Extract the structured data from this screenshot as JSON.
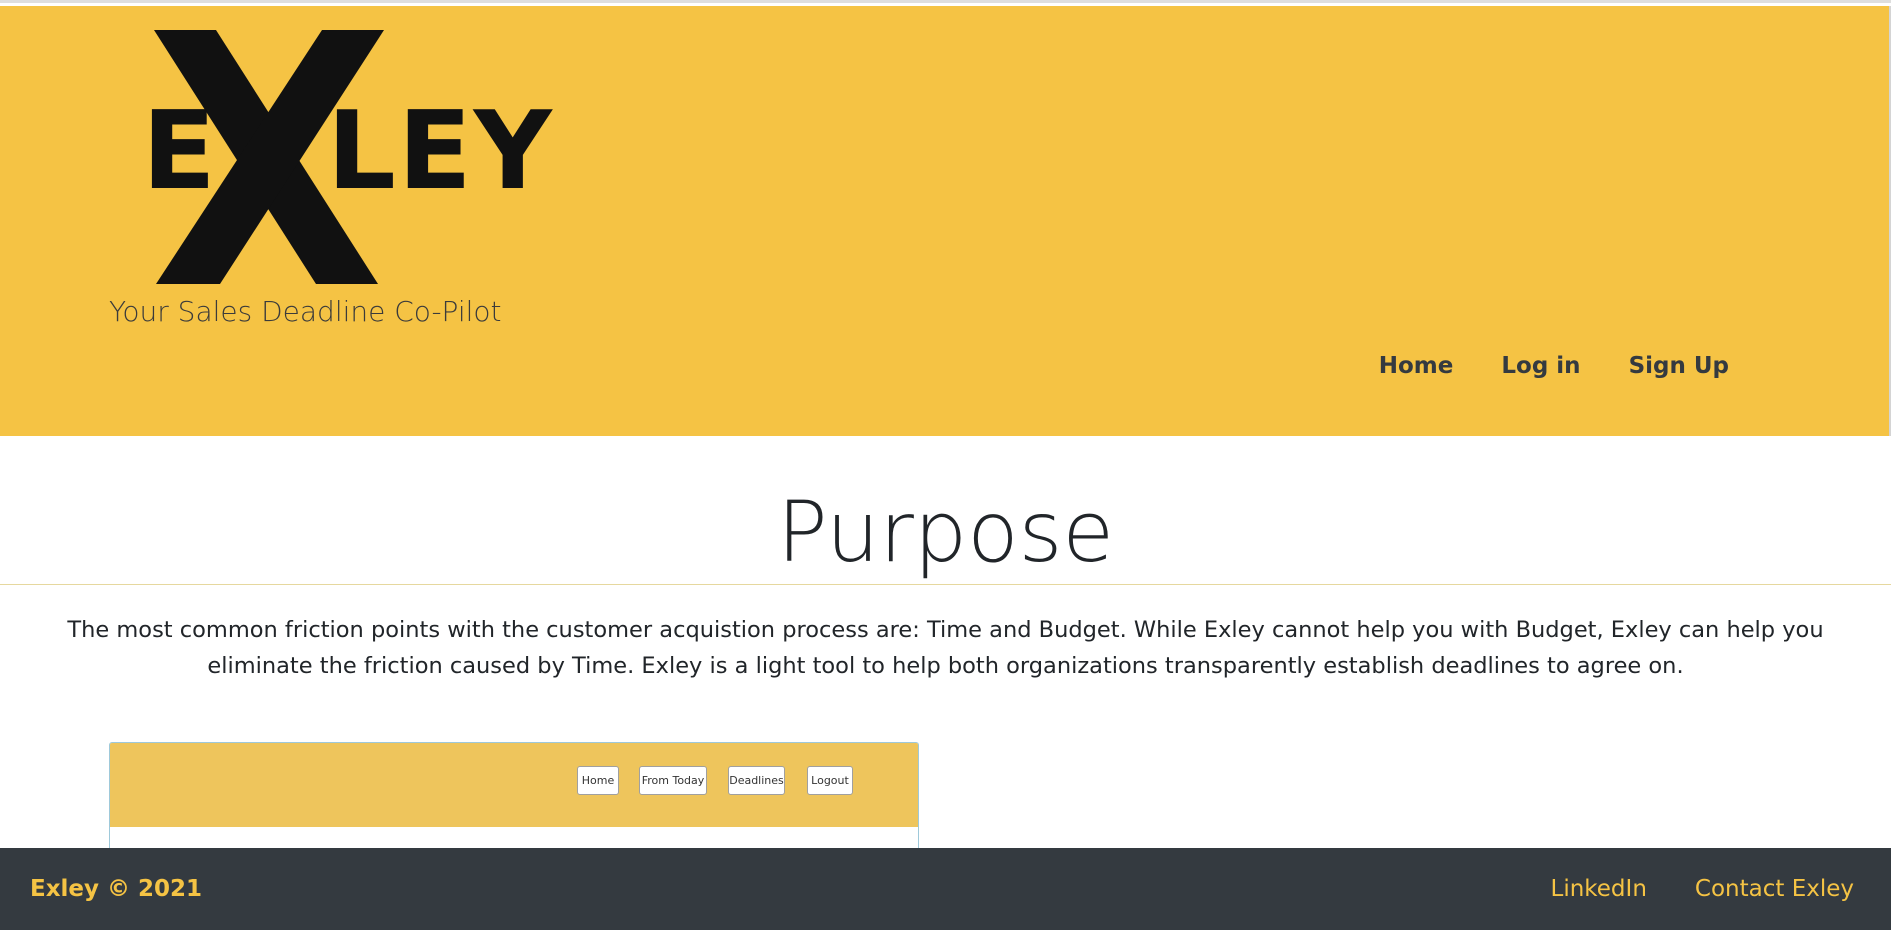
{
  "brand": {
    "logo_text": "EXLEY",
    "logo_left": "E",
    "logo_right": "LEY",
    "tagline": "Your Sales Deadline Co-Pilot"
  },
  "nav": {
    "items": [
      {
        "label": "Home"
      },
      {
        "label": "Log in"
      },
      {
        "label": "Sign Up"
      }
    ]
  },
  "main": {
    "title": "Purpose",
    "body": "The most common friction points with the customer acquistion process are: Time and Budget. While Exley cannot help you with Budget, Exley can help you eliminate the friction caused by Time. Exley is a light tool to help both organizations transparently establish deadlines to agree on."
  },
  "preview": {
    "buttons": [
      {
        "label": "Home"
      },
      {
        "label": "From Today"
      },
      {
        "label": "Deadlines"
      },
      {
        "label": "Logout"
      }
    ]
  },
  "footer": {
    "copyright": "Exley © 2021",
    "links": [
      {
        "label": "LinkedIn"
      },
      {
        "label": "Contact Exley"
      }
    ]
  },
  "colors": {
    "header_bg": "#f5c344",
    "footer_bg": "#343a40",
    "accent": "#f5c344",
    "text_dark": "#212529"
  }
}
